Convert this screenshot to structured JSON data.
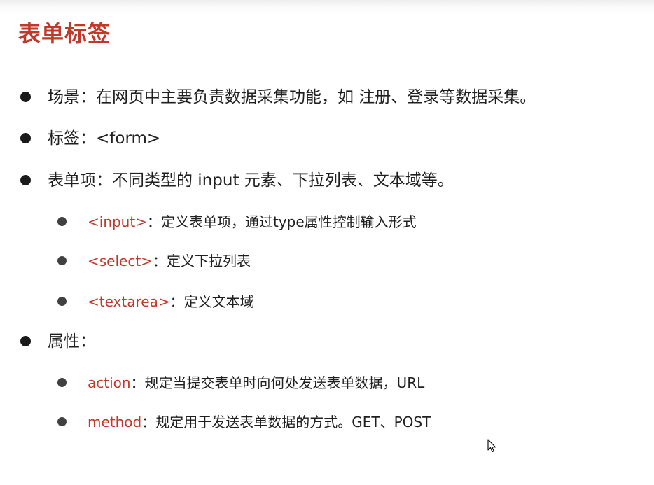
{
  "title": "表单标签",
  "items": {
    "scene": "场景：在网页中主要负责数据采集功能，如 注册、登录等数据采集。",
    "tag": "标签：<form>",
    "form_items": "表单项：不同类型的 input 元素、下拉列表、文本域等。",
    "sub_items": [
      {
        "tag": "<input>",
        "desc": "：定义表单项，通过type属性控制输入形式"
      },
      {
        "tag": "<select>",
        "desc": "：定义下拉列表"
      },
      {
        "tag": "<textarea>",
        "desc": "：定义文本域"
      }
    ],
    "attributes": "属性：",
    "attr_items": [
      {
        "name": "action",
        "desc": "：规定当提交表单时向何处发送表单数据，URL"
      },
      {
        "name": "method",
        "desc": "：规定用于发送表单数据的方式。GET、POST"
      }
    ]
  }
}
